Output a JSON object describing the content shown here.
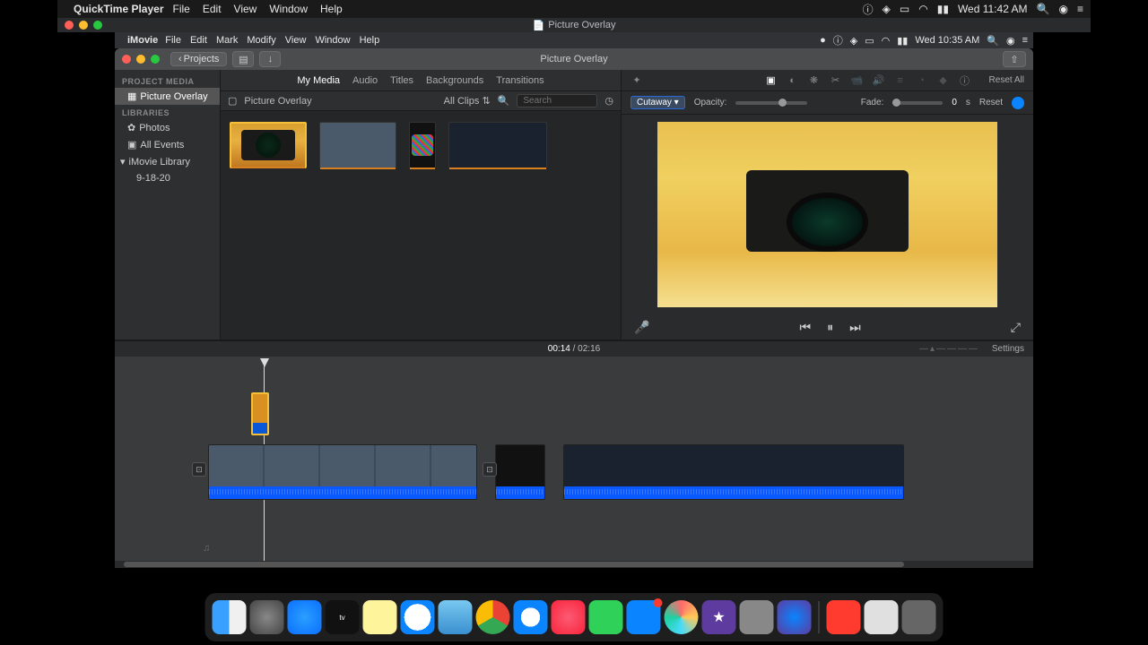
{
  "outer_menubar": {
    "app": "QuickTime Player",
    "items": [
      "File",
      "Edit",
      "View",
      "Window",
      "Help"
    ],
    "clock": "Wed 11:42 AM"
  },
  "outer_titlebar": {
    "title": "Picture Overlay"
  },
  "inner_menubar": {
    "app": "iMovie",
    "items": [
      "File",
      "Edit",
      "Mark",
      "Modify",
      "View",
      "Window",
      "Help"
    ],
    "clock": "Wed 10:35 AM"
  },
  "window": {
    "title": "Picture Overlay",
    "back": "Projects",
    "sidebar": {
      "project_media_header": "PROJECT MEDIA",
      "project_item": "Picture Overlay",
      "libraries_header": "LIBRARIES",
      "photos": "Photos",
      "all_events": "All Events",
      "library": "iMovie Library",
      "event": "9-18-20"
    },
    "tabs": [
      "My Media",
      "Audio",
      "Titles",
      "Backgrounds",
      "Transitions"
    ],
    "browser": {
      "title": "Picture Overlay",
      "filter": "All Clips",
      "search_placeholder": "Search"
    },
    "adjust": {
      "reset_all": "Reset All"
    },
    "overlay": {
      "mode": "Cutaway",
      "opacity_label": "Opacity:",
      "fade_label": "Fade:",
      "fade_value": "0",
      "fade_unit": "s",
      "reset": "Reset"
    },
    "timecode": {
      "current": "00:14",
      "total": "02:16",
      "settings": "Settings"
    }
  },
  "dock": {
    "appletv": "tv"
  }
}
